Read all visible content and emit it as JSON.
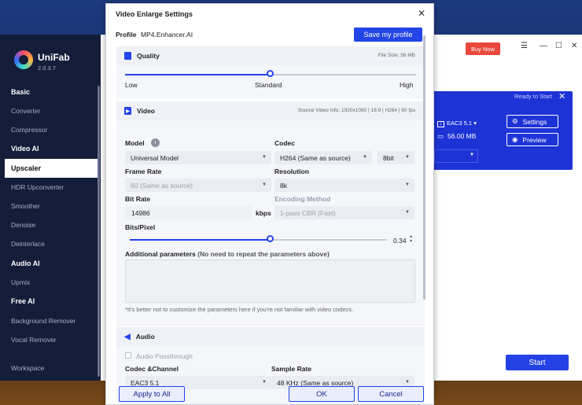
{
  "app": {
    "brand": "UniFab",
    "version": "2.0.3.7",
    "buy_now": "Buy Now",
    "controls": [
      "☰",
      "—",
      "☐",
      "✕"
    ]
  },
  "sidebar": {
    "basic": "Basic",
    "converter": "Converter",
    "compressor": "Compressor",
    "video_ai": "Video AI",
    "upscaler": "Upscaler",
    "hdr": "HDR Upconverter",
    "smoother": "Smoother",
    "denoise": "Denoise",
    "deinterlace": "Deinterlace",
    "audio_ai": "Audio AI",
    "upmix": "Upmix",
    "free_ai": "Free AI",
    "bg_remover": "Background Remover",
    "vocal_remover": "Vocal Remover",
    "workspace": "Workspace"
  },
  "task_card": {
    "ready": "Ready to Start",
    "audio_format": "EAC3 5.1",
    "file_size": "56.00 MB",
    "settings": "Settings",
    "preview": "Preview",
    "start": "Start"
  },
  "dialog": {
    "title": "Video Enlarge Settings",
    "profile_label": "Profile",
    "profile_value": "MP4.Enhancer.AI",
    "save_profile": "Save my profile",
    "quality": {
      "heading": "Quality",
      "file_size": "File Size:  56 MB",
      "low": "Low",
      "standard": "Standard",
      "high": "High",
      "level": 0.5
    },
    "video": {
      "heading": "Video",
      "source_info": "Source Video Info: 1920x1080 | 16:9 | H264 | 60 fps",
      "model_label": "Model",
      "model_value": "Universal Model",
      "codec_label": "Codec",
      "codec_value": "H264 (Same as source)",
      "bitdepth_value": "8bit",
      "frame_rate_label": "Frame Rate",
      "frame_rate_value": "60 (Same as source)",
      "resolution_label": "Resolution",
      "resolution_value": "8k",
      "bit_rate_label": "Bit Rate",
      "bit_rate_value": "14986",
      "bit_rate_unit": "kbps",
      "encoding_label": "Encoding Method",
      "encoding_value": "1-pass CBR (Fast)",
      "bits_pixel_label": "Bits/Pixel",
      "bits_pixel_value": "0.34",
      "additional_label": "Additional parameters",
      "additional_hint": "(No need to repeat the parameters above)",
      "note": "*It's better not to customize the parameters here if you're not familiar with video codecs."
    },
    "audio": {
      "heading": "Audio",
      "passthrough": "Audio Passthrough",
      "codec_channel_label": "Codec &Channel",
      "codec_channel_value": "EAC3 5.1",
      "sample_rate_label": "Sample Rate",
      "sample_rate_value": "48 KHz (Same as source)"
    },
    "apply_all": "Apply to All",
    "ok": "OK",
    "cancel": "Cancel"
  }
}
